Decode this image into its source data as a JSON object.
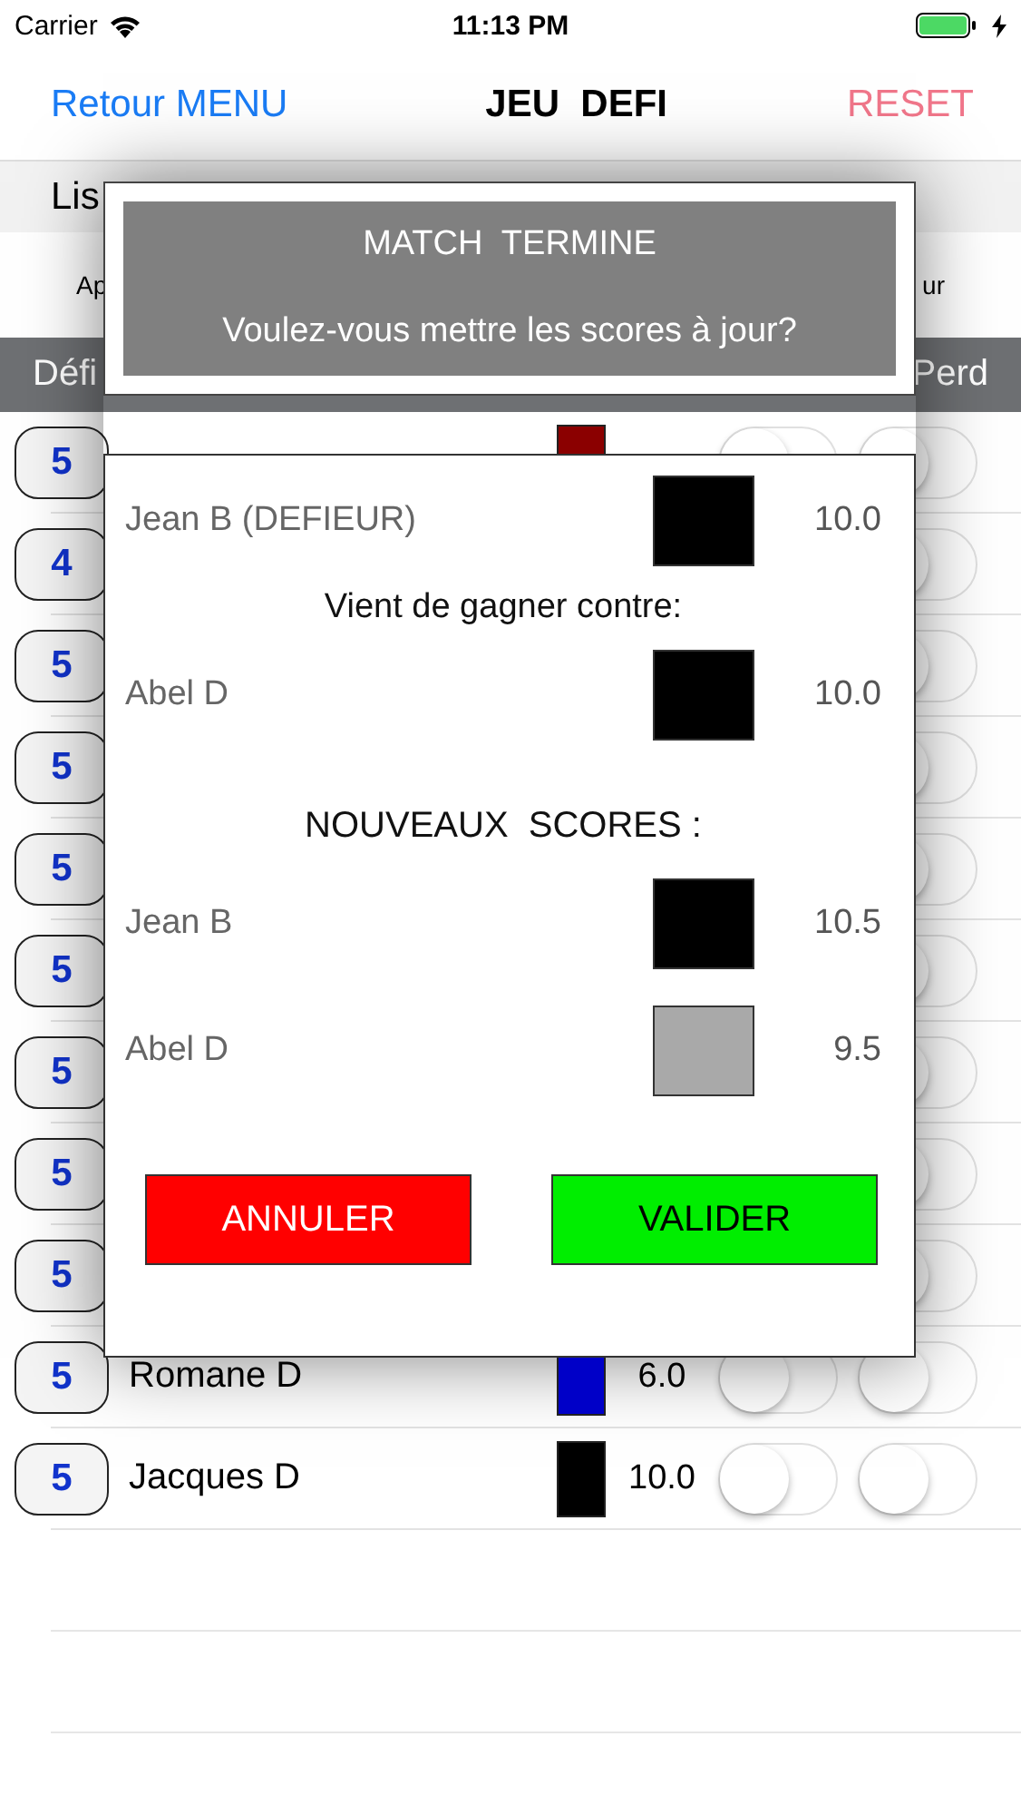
{
  "status_bar": {
    "carrier": "Carrier",
    "time": "11:13 PM"
  },
  "nav": {
    "back": "Retour MENU",
    "title": "JEU  DEFI",
    "reset": "RESET"
  },
  "list_header": {
    "text": "Lis"
  },
  "options": {
    "left": "Ap",
    "right": "ur"
  },
  "columns": {
    "left": "Défi",
    "right": "Perd"
  },
  "rows": [
    {
      "badge": "5",
      "color": "#8b0000",
      "defi_toggle": {
        "on": false
      },
      "perd_toggle": {
        "on": false
      }
    },
    {
      "badge": "4",
      "perd_toggle": {
        "on": false
      }
    },
    {
      "badge": "5",
      "perd_toggle": {
        "on": false
      }
    },
    {
      "badge": "5",
      "perd_toggle": {
        "on": false
      }
    },
    {
      "badge": "5",
      "perd_toggle": {
        "on": false
      }
    },
    {
      "badge": "5",
      "perd_toggle": {
        "on": false
      }
    },
    {
      "badge": "5",
      "perd_toggle": {
        "on": false
      }
    },
    {
      "badge": "5",
      "perd_toggle": {
        "on": false
      }
    },
    {
      "badge": "5",
      "perd_toggle": {
        "on": false
      }
    },
    {
      "badge": "5",
      "name": "Romane D",
      "color": "#0000c8",
      "score": "6.0",
      "defi_toggle": {
        "on": false
      },
      "perd_toggle": {
        "on": false
      }
    },
    {
      "badge": "5",
      "name": "Jacques D",
      "color": "#000000",
      "score": "10.0",
      "defi_toggle": {
        "on": false
      },
      "perd_toggle": {
        "on": false
      }
    }
  ],
  "alert": {
    "title": "MATCH  TERMINE",
    "message": "Voulez-vous mettre les scores à jour?"
  },
  "dialog": {
    "winner": {
      "name": "Jean B (DEFIEUR)",
      "color": "#000000",
      "score": "10.0"
    },
    "caption": "Vient de gagner contre:",
    "loser": {
      "name": "Abel D",
      "color": "#000000",
      "score": "10.0"
    },
    "new_heading": "NOUVEAUX  SCORES :",
    "new_scores": [
      {
        "name": "Jean B",
        "color": "#000000",
        "score": "10.5"
      },
      {
        "name": "Abel D",
        "color": "#a9a9a9",
        "score": "9.5"
      }
    ],
    "buttons": [
      {
        "label": "ANNULER",
        "kind": "cancel"
      },
      {
        "label": "VALIDER",
        "kind": "confirm"
      }
    ]
  }
}
